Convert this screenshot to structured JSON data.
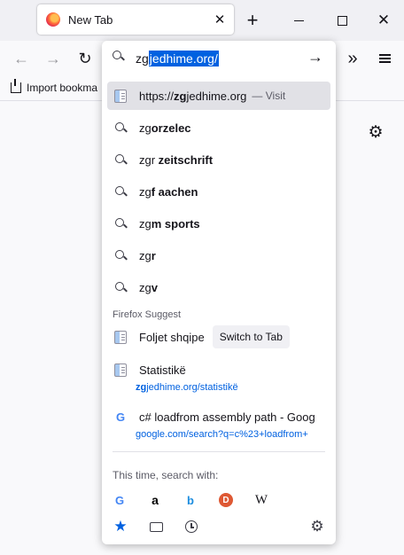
{
  "window": {
    "tab_title": "New Tab",
    "close_tab_glyph": "✕",
    "new_tab_glyph": "+",
    "close_window_glyph": "✕"
  },
  "navbar": {
    "back_glyph": "←",
    "forward_glyph": "→",
    "reload_glyph": "↻",
    "overflow_glyph": "»"
  },
  "bookmarks": {
    "import_label": "Import bookma"
  },
  "content": {
    "gear_glyph": "⚙"
  },
  "urlbar": {
    "typed": "zg",
    "autofill_selected": "jedhime.org/",
    "go_glyph": "→"
  },
  "results": {
    "heuristic": {
      "prefix": "https://",
      "bold": "zg",
      "rest": "jedhime.org",
      "action": "— Visit"
    },
    "suggestions": [
      {
        "plain": "zg",
        "bold": "orzelec"
      },
      {
        "plain": "zgr ",
        "bold": "zeitschrift"
      },
      {
        "plain": "zg",
        "bold": "f aachen"
      },
      {
        "plain": "zg",
        "bold": "m sports"
      },
      {
        "plain": "zg",
        "bold": "r"
      },
      {
        "plain": "zg",
        "bold": "v"
      }
    ],
    "section_label": "Firefox Suggest",
    "tab_result": {
      "title": "Foljet shqipe",
      "button": "Switch to Tab"
    },
    "history_1": {
      "title": "Statistikë",
      "url_bold": "zg",
      "url_rest": "jedhime.org/statistikë"
    },
    "history_2": {
      "icon": "G",
      "title": "c# loadfrom assembly path - Goog",
      "url": "google.com/search?q=c%23+loadfrom+"
    }
  },
  "search_with": {
    "label": "This time, search with:",
    "engines": {
      "google": "G",
      "amazon": "a",
      "bing": "b",
      "ddg": "D",
      "wikipedia": "W"
    },
    "modes": {
      "bookmarks": "★",
      "settings": "⚙"
    }
  },
  "colors": {
    "accent": "#0061e0",
    "selected_row": "#e1e1e6"
  }
}
